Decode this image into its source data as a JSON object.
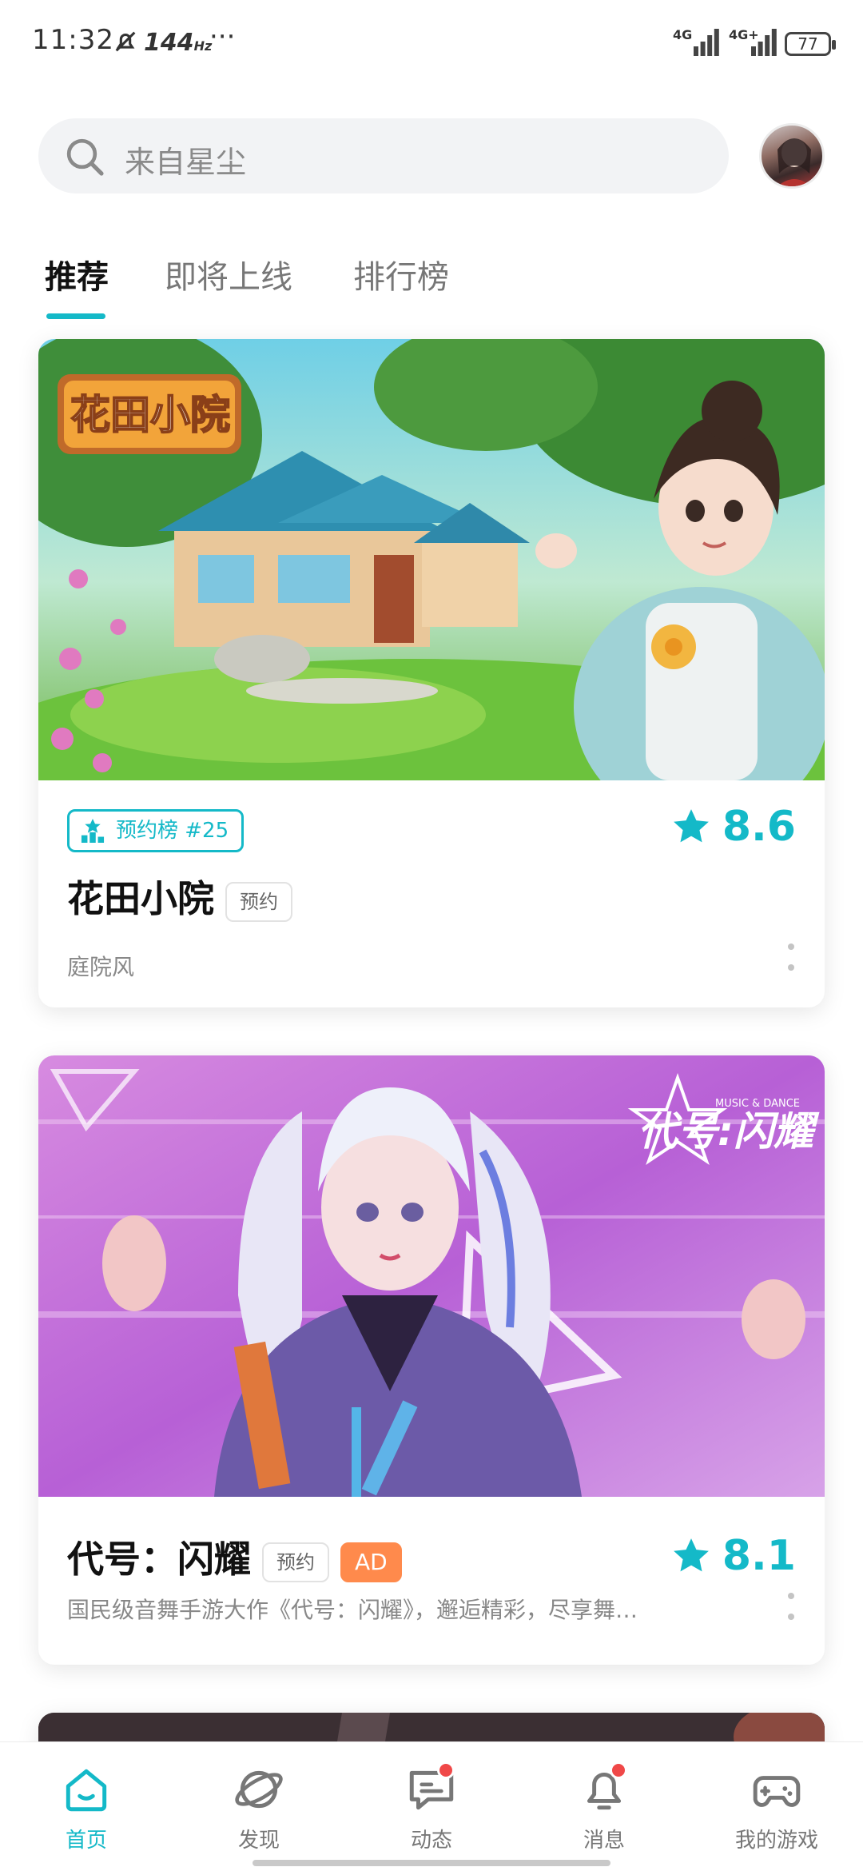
{
  "status_bar": {
    "time": "11:32",
    "refresh_rate": "144",
    "refresh_unit": "Hz",
    "more": "···",
    "network_1": "4G",
    "network_2": "4G+",
    "battery": "77"
  },
  "search": {
    "placeholder": "来自星尘"
  },
  "tabs": [
    {
      "label": "推荐",
      "active": true
    },
    {
      "label": "即将上线",
      "active": false
    },
    {
      "label": "排行榜",
      "active": false
    }
  ],
  "cards": [
    {
      "banner_logo": "花田小院",
      "rank_badge": "预约榜  #25",
      "rating": "8.6",
      "title": "花田小院",
      "tag": "预约",
      "subtitle": "庭院风"
    },
    {
      "banner_logo": "代号:闪耀",
      "banner_logo_small": "MUSIC & DANCE",
      "rating": "8.1",
      "title": "代号：闪耀",
      "tag": "预约",
      "ad_tag": "AD",
      "subtitle": "国民级音舞手游大作《代号：闪耀》，邂逅精彩，尽享舞…"
    }
  ],
  "bottom_nav": [
    {
      "label": "首页",
      "icon": "home-icon",
      "active": true
    },
    {
      "label": "发现",
      "icon": "planet-icon",
      "active": false
    },
    {
      "label": "动态",
      "icon": "chat-icon",
      "active": false,
      "badge": true
    },
    {
      "label": "消息",
      "icon": "bell-icon",
      "active": false,
      "badge": true
    },
    {
      "label": "我的游戏",
      "icon": "gamepad-icon",
      "active": false
    }
  ],
  "colors": {
    "accent": "#14b9c8",
    "ad_orange": "#ff8a4c",
    "badge_red": "#f04848"
  }
}
